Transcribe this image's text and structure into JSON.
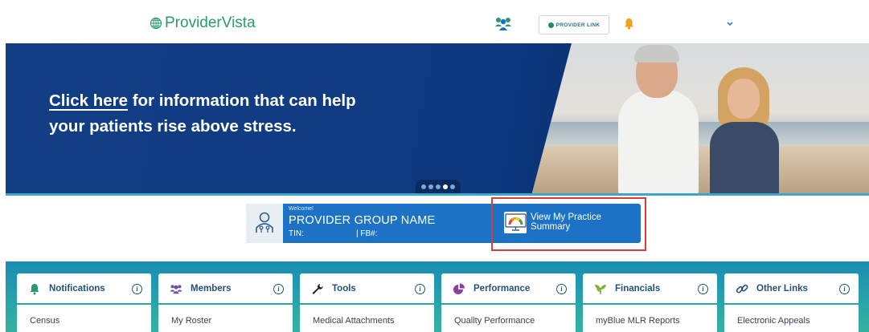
{
  "header": {
    "logo_text": "ProviderVista",
    "provider_link_label": "PROVIDER LINK",
    "icons": [
      "globe-icon",
      "people-icon",
      "bell-icon",
      "chevron-down-icon"
    ]
  },
  "hero": {
    "link_text": "Click here",
    "text_line1": " for information that can help",
    "text_line2": "your patients rise above stress.",
    "carousel_dots": 5,
    "active_dot": 4
  },
  "welcome": {
    "greeting": "Welcome!",
    "group_name": "PROVIDER GROUP NAME",
    "tin_label": "TIN:",
    "fb_label": "| FB#:",
    "practice_summary_label": "View My Practice Summary"
  },
  "cards": [
    {
      "title": "Notifications",
      "icon": "bell-icon",
      "item": "Census"
    },
    {
      "title": "Members",
      "icon": "members-icon",
      "item": "My Roster"
    },
    {
      "title": "Tools",
      "icon": "wrench-icon",
      "item": "Medical Attachments"
    },
    {
      "title": "Performance",
      "icon": "pie-chart-icon",
      "item": "Quality Performance"
    },
    {
      "title": "Financials",
      "icon": "plant-icon",
      "item": "myBlue MLR Reports"
    },
    {
      "title": "Other Links",
      "icon": "link-icon",
      "item": "Electronic Appeals"
    }
  ],
  "info_symbol": "i",
  "colors": {
    "brand_green": "#2a9a6e",
    "hero_blue": "#123e84",
    "welcome_blue": "#1c73c6",
    "card_title": "#23507c",
    "highlight_red": "#d93a3a",
    "teal": "#2aa5a8"
  }
}
